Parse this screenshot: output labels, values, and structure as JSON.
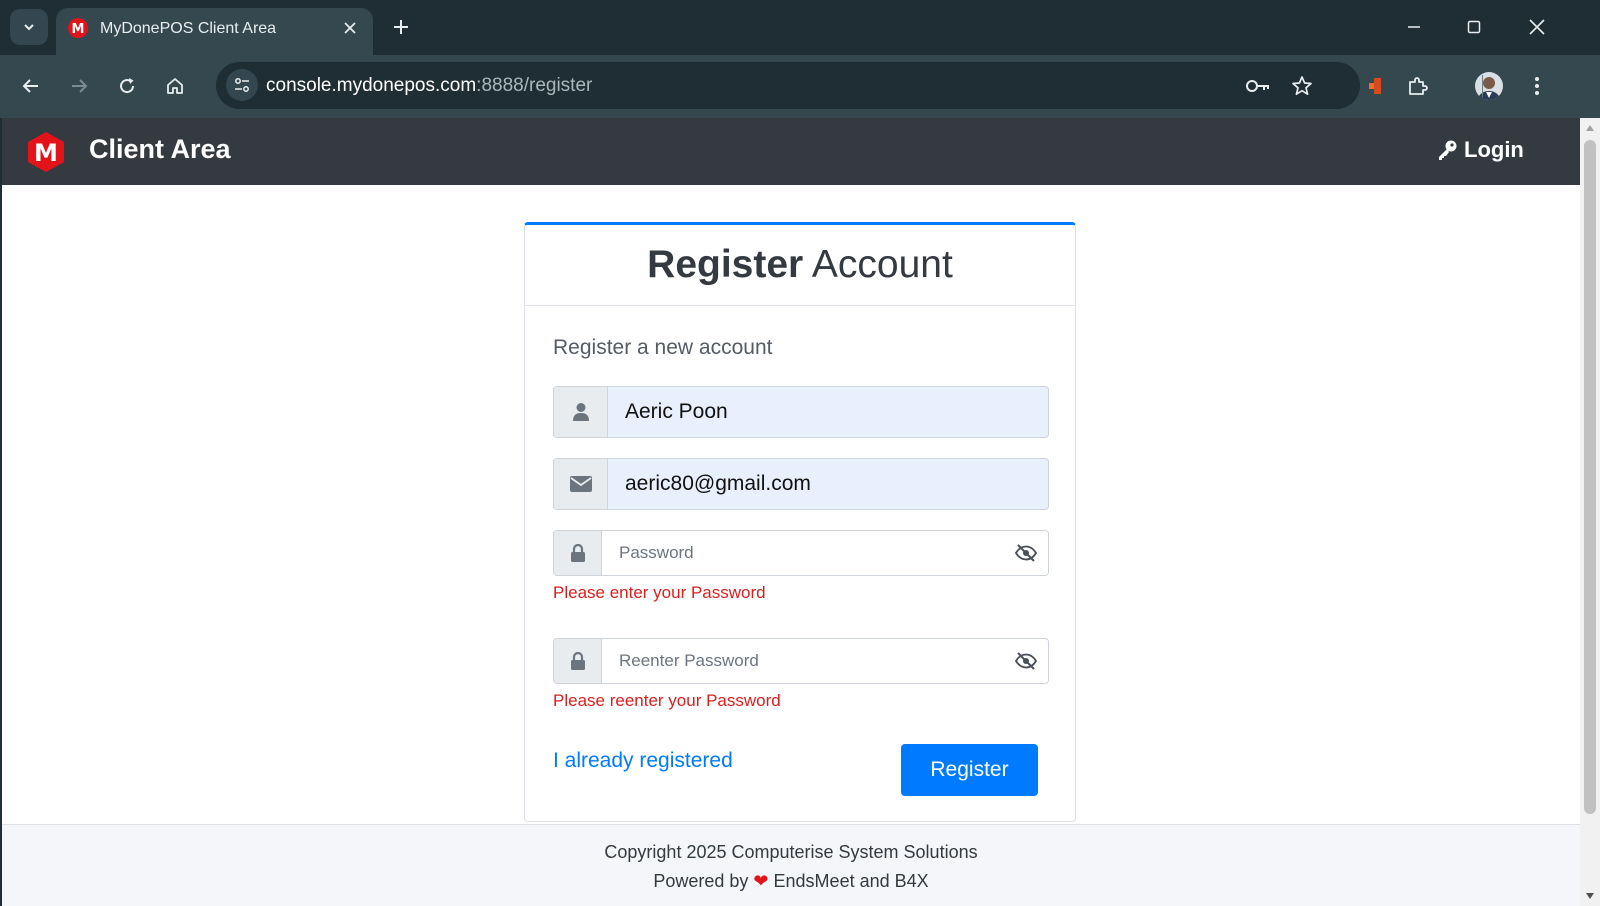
{
  "browser": {
    "tab_title": "MyDonePOS Client Area",
    "url_host": "console.mydonepos.com",
    "url_path": ":8888/register"
  },
  "app": {
    "brand_title": "Client Area",
    "login_label": "Login"
  },
  "form": {
    "title_bold": "Register",
    "title_rest": " Account",
    "subtitle": "Register a new account",
    "name_value": "Aeric Poon",
    "email_value": "aeric80@gmail.com",
    "password_placeholder": "Password",
    "password_error": "Please enter your Password",
    "reenter_placeholder": "Reenter Password",
    "reenter_error": "Please reenter your Password",
    "already_link": "I already registered",
    "register_button": "Register"
  },
  "footer": {
    "copyright": "Copyright 2025 Computerise System Solutions",
    "powered_prefix": "Powered by",
    "powered_suffix": "EndsMeet and B4X"
  },
  "colors": {
    "accent": "#007bff",
    "error": "#dc1e1e",
    "appbar": "#343a40",
    "brand_red": "#e3131a"
  }
}
